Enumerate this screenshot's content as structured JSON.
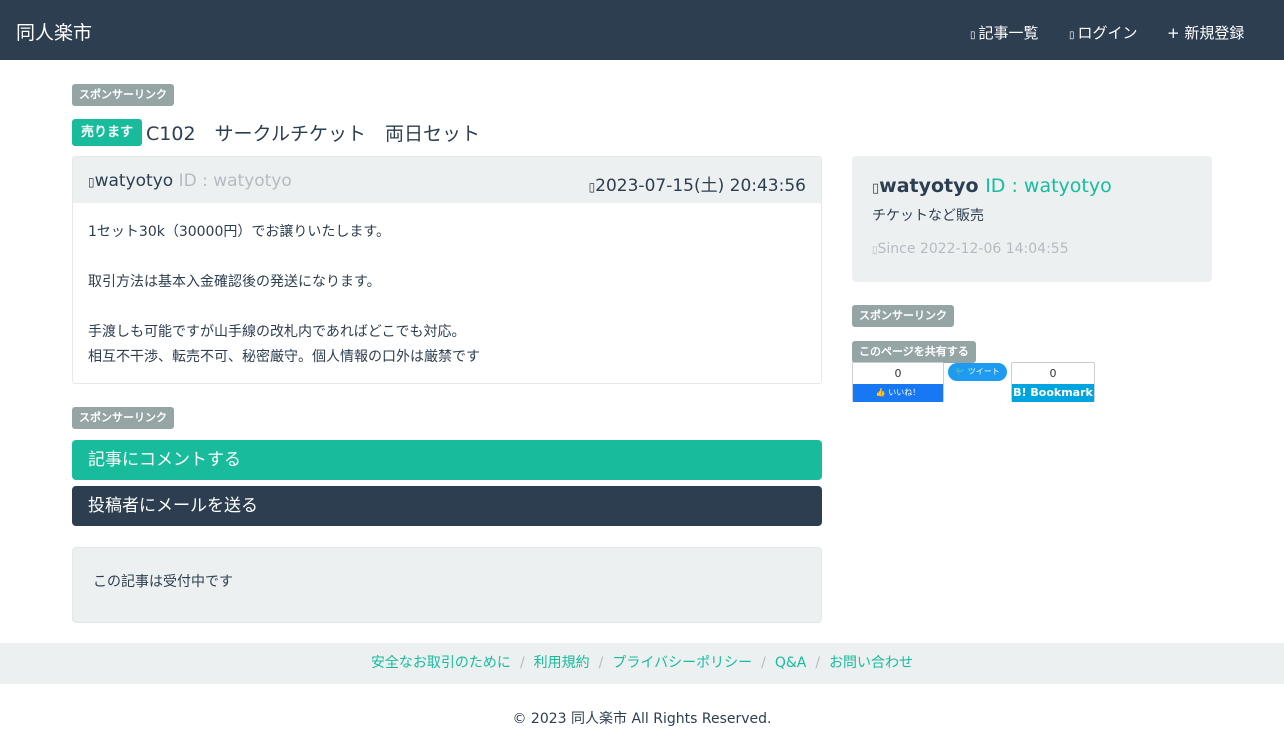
{
  "nav": {
    "brand": "同人楽市",
    "articles_icon": "list-icon",
    "articles_label": "記事一覧",
    "login_icon": "sign-in-icon",
    "login_label": "ログイン",
    "register_label": "+ 新規登録"
  },
  "labels": {
    "sponsor": "スポンサーリンク",
    "share": "このページを共有する"
  },
  "post": {
    "badge": "売ります",
    "title": "C102　サークルチケット　両日セット",
    "author_icon": "user-icon",
    "author": "watyotyo",
    "author_id": "ID : watyotyo",
    "date_icon": "clock-icon",
    "date": "2023-07-15(土) 20:43:56",
    "body_lines": [
      "1セット30k（30000円）でお譲りいたします。",
      "",
      "取引方法は基本入金確認後の発送になります。",
      "",
      "手渡しも可能ですが山手線の改札内であればどこでも対応。",
      "相互不干渉、転売不可、秘密厳守。個人情報の口外は厳禁です"
    ]
  },
  "actions": {
    "comment": "記事にコメントする",
    "mail": "投稿者にメールを送る"
  },
  "status": "この記事は受付中です",
  "profile": {
    "icon": "user-icon",
    "name": "watyotyo",
    "id": "ID : watyotyo",
    "description": "チケットなど販売",
    "since_icon": "calendar-icon",
    "since": "Since 2022-12-06 14:04:55"
  },
  "share": {
    "facebook_count": "0",
    "facebook_label": "いいね！",
    "twitter_label": "ツイート",
    "hatena_count": "0",
    "hatena_label": "B! Bookmark"
  },
  "footer": {
    "links": [
      "安全なお取引のために",
      "利用規約",
      "プライバシーポリシー",
      "Q&A",
      "お問い合わせ"
    ],
    "separator": "/",
    "copyright": "© 2023 同人楽市 All Rights Reserved."
  },
  "colors": {
    "navbar": "#2c3e50",
    "accent": "#18bc9c",
    "label_grey": "#95a5a6",
    "panel": "#ecf0f1"
  }
}
